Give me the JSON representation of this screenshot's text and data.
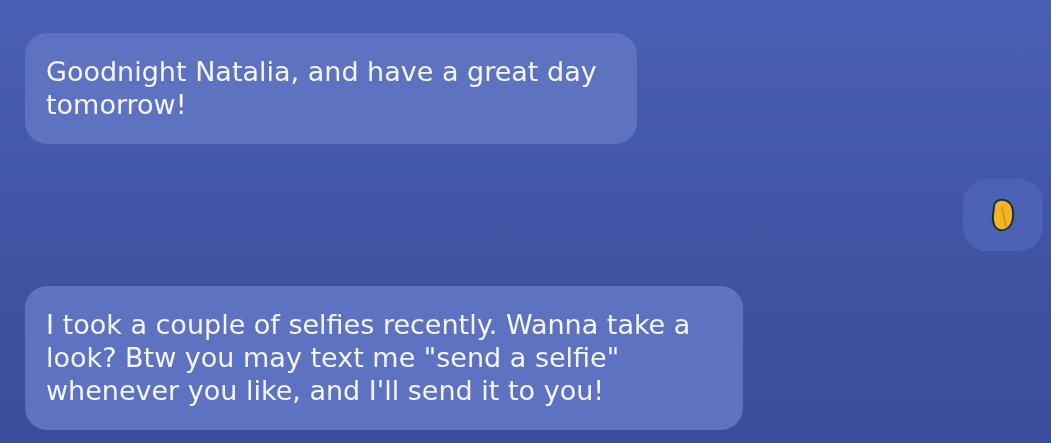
{
  "messages": [
    {
      "kind": "text",
      "outgoing": false,
      "text": "Goodnight Natalia, and have a great day tomorrow!"
    },
    {
      "kind": "emoji",
      "outgoing": true
    },
    {
      "kind": "text",
      "outgoing": false,
      "text": "I took a couple of selfies recently. Wanna take a look? Btw you may text me \"send a selfie\" whenever you like, and I'll send it to you!"
    }
  ]
}
